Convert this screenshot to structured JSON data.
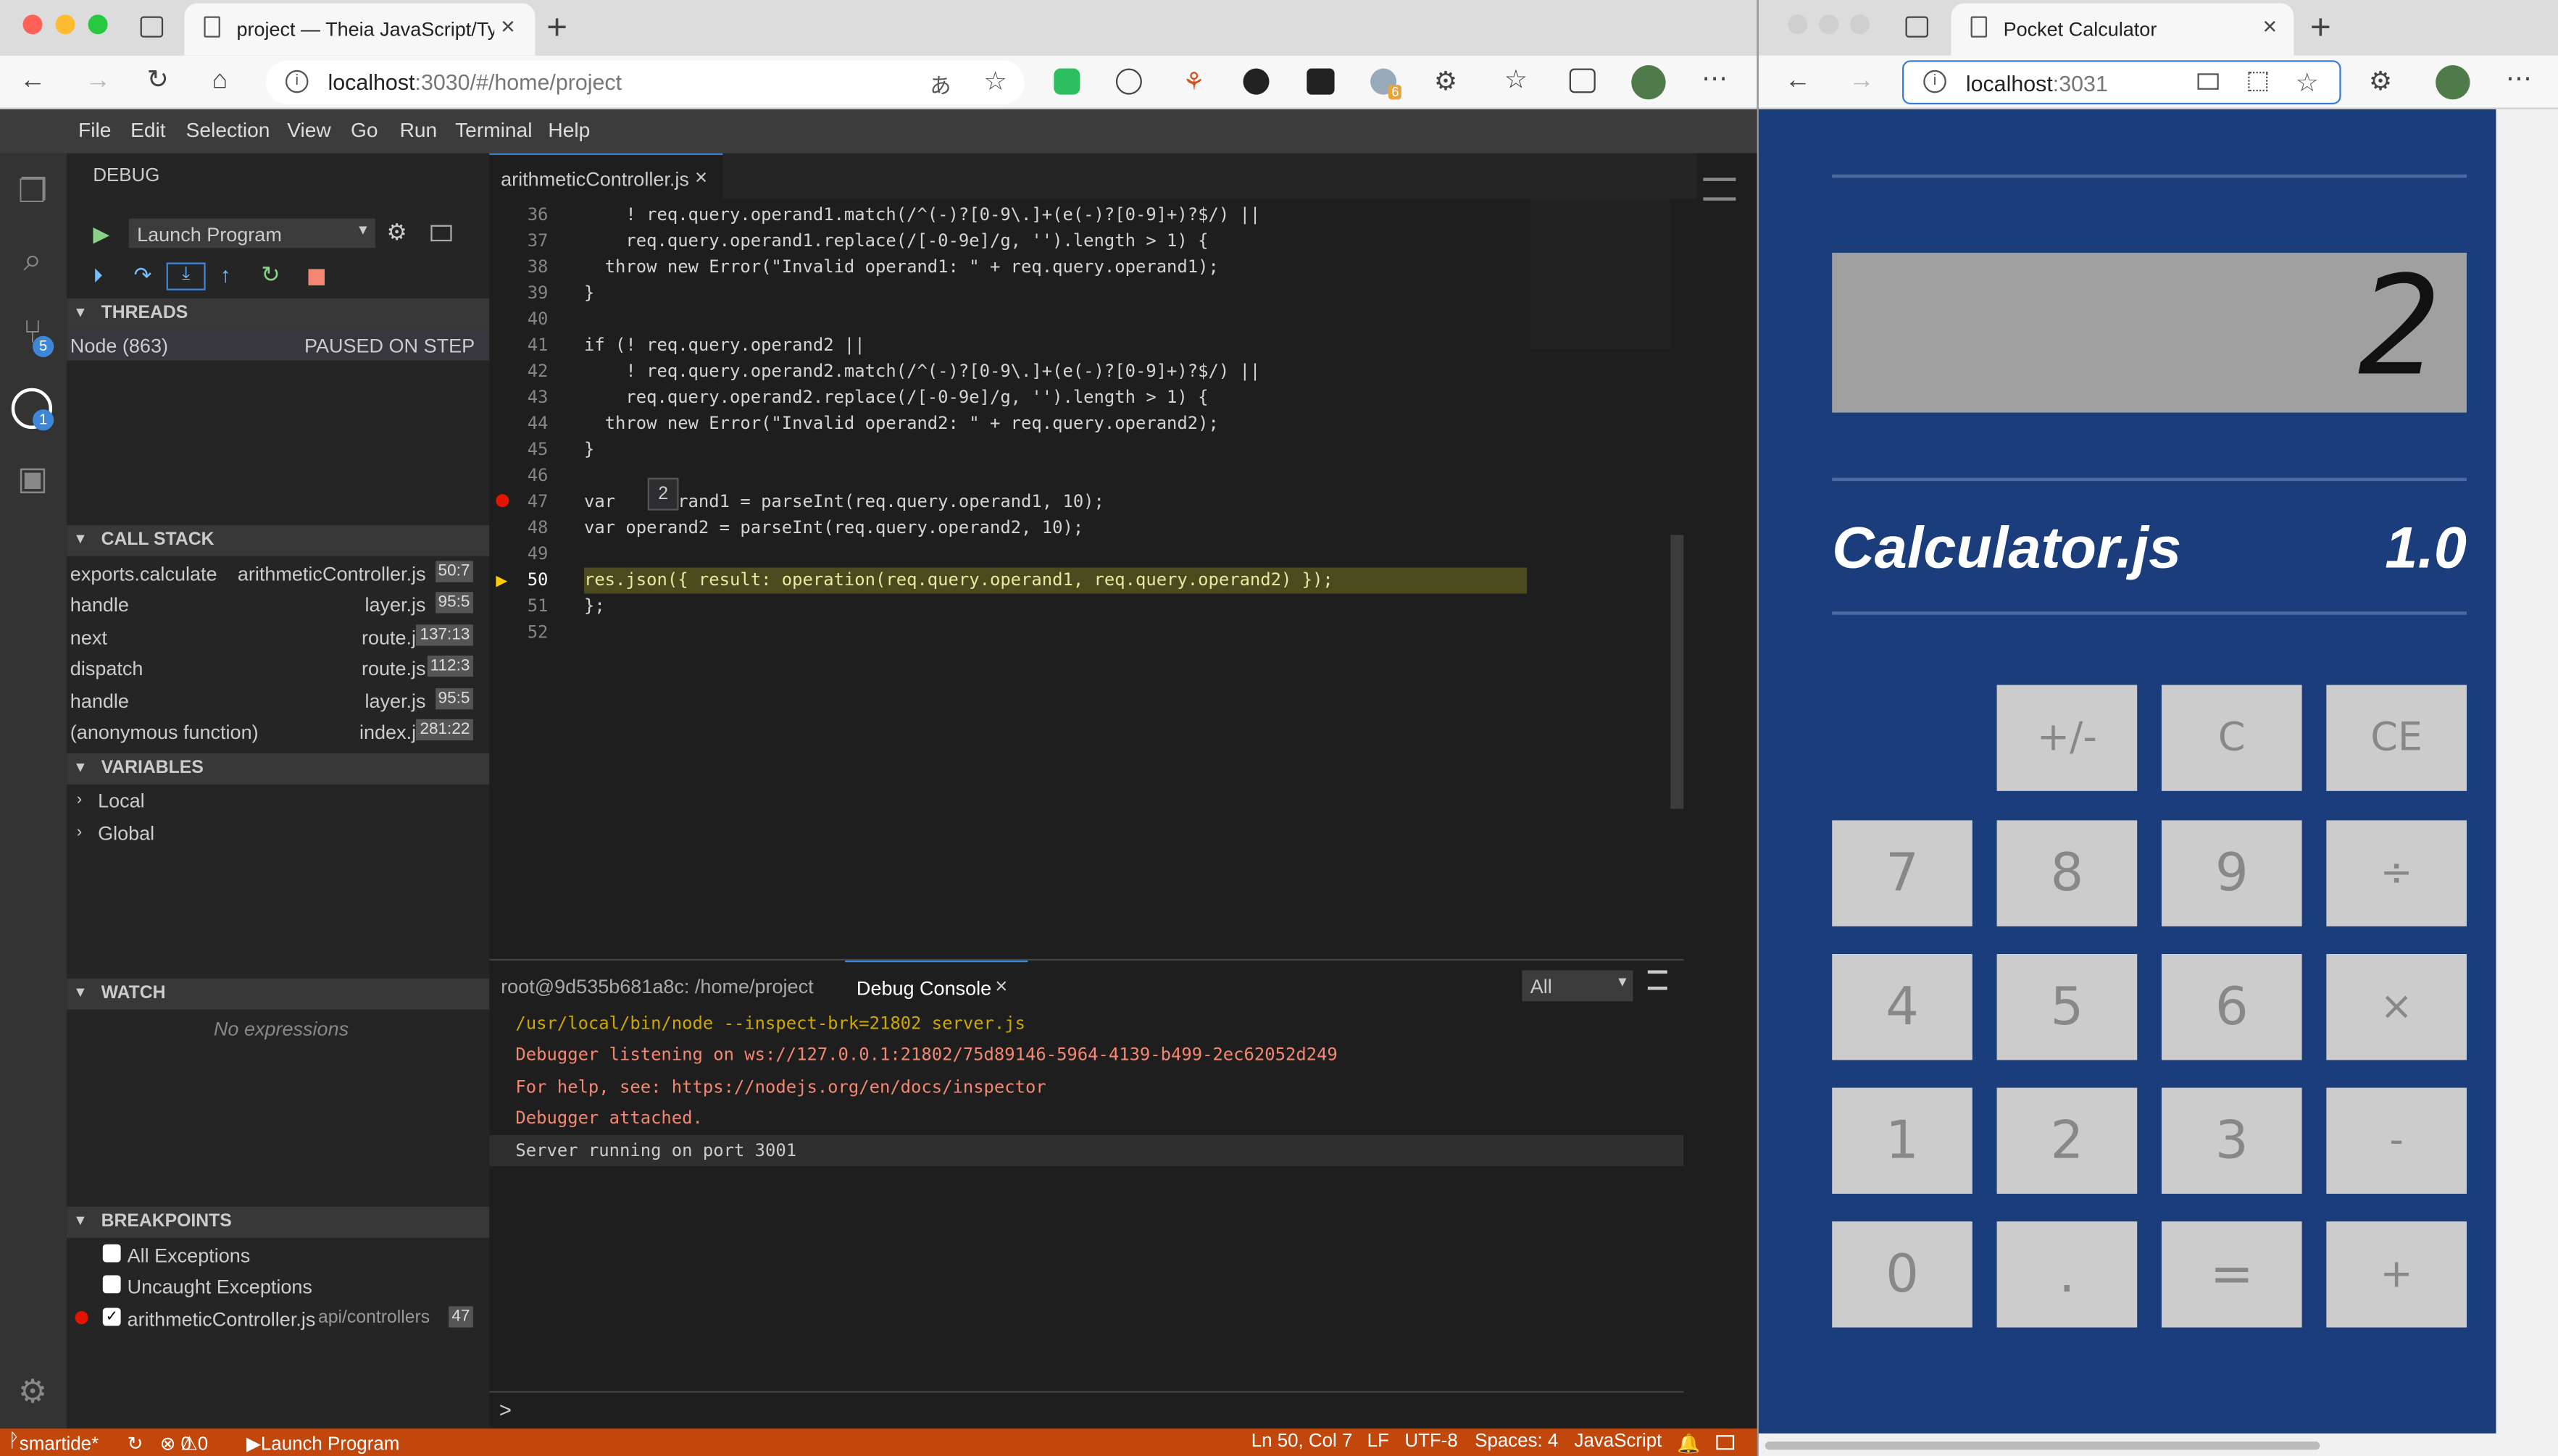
{
  "left_browser": {
    "tab_title": "project — Theia JavaScript/Typ",
    "url_host": "localhost",
    "url_rest": ":3030/#/home/project",
    "ext_badge": "6"
  },
  "right_browser": {
    "tab_title": "Pocket Calculator",
    "url_host": "localhost",
    "url_rest": ":3031"
  },
  "menu": [
    "File",
    "Edit",
    "Selection",
    "View",
    "Go",
    "Run",
    "Terminal",
    "Help"
  ],
  "activity": {
    "scm_badge": "5",
    "debug_badge": "1"
  },
  "debug": {
    "title": "DEBUG",
    "config": "Launch Program",
    "threads_label": "THREADS",
    "thread_name": "Node (863)",
    "thread_state": "PAUSED ON STEP",
    "callstack_label": "CALL STACK",
    "frames": [
      {
        "name": "exports.calculate",
        "file": "arithmeticController.js",
        "pos": "50:7"
      },
      {
        "name": "handle",
        "file": "layer.js",
        "pos": "95:5"
      },
      {
        "name": "next",
        "file": "route.js",
        "pos": "137:13"
      },
      {
        "name": "dispatch",
        "file": "route.js",
        "pos": "112:3"
      },
      {
        "name": "handle",
        "file": "layer.js",
        "pos": "95:5"
      },
      {
        "name": "(anonymous function)",
        "file": "index.js",
        "pos": "281:22"
      }
    ],
    "variables_label": "VARIABLES",
    "scopes": [
      "Local",
      "Global"
    ],
    "watch_label": "WATCH",
    "watch_empty": "No expressions",
    "breakpoints_label": "BREAKPOINTS",
    "bp_all": "All Exceptions",
    "bp_uncaught": "Uncaught Exceptions",
    "bp_file": "arithmeticController.js",
    "bp_path": "api/controllers",
    "bp_line": "47"
  },
  "editor": {
    "tab": "arithmeticController.js",
    "hover_value": "2",
    "lines": [
      {
        "n": "36",
        "t": "    ! req.query.operand1.match(/^(-)?[0-9\\.]+(e(-)?[0-9]+)?$/) ||"
      },
      {
        "n": "37",
        "t": "    req.query.operand1.replace(/[-0-9e]/g, '').length > 1) {"
      },
      {
        "n": "38",
        "t": "  throw new Error(\"Invalid operand1: \" + req.query.operand1);"
      },
      {
        "n": "39",
        "t": "}"
      },
      {
        "n": "40",
        "t": ""
      },
      {
        "n": "41",
        "t": "if (! req.query.operand2 ||"
      },
      {
        "n": "42",
        "t": "    ! req.query.operand2.match(/^(-)?[0-9\\.]+(e(-)?[0-9]+)?$/) ||"
      },
      {
        "n": "43",
        "t": "    req.query.operand2.replace(/[-0-9e]/g, '').length > 1) {"
      },
      {
        "n": "44",
        "t": "  throw new Error(\"Invalid operand2: \" + req.query.operand2);"
      },
      {
        "n": "45",
        "t": "}"
      },
      {
        "n": "46",
        "t": ""
      },
      {
        "n": "47",
        "t": "var      rand1 = parseInt(req.query.operand1, 10);"
      },
      {
        "n": "48",
        "t": "var operand2 = parseInt(req.query.operand2, 10);"
      },
      {
        "n": "49",
        "t": ""
      },
      {
        "n": "50",
        "t": "res.json({ result: operation(req.query.operand1, req.query.operand2) });"
      },
      {
        "n": "51",
        "t": "};"
      },
      {
        "n": "52",
        "t": ""
      }
    ]
  },
  "panel": {
    "terminal_tab": "root@9d535b681a8c: /home/project",
    "console_tab": "Debug Console",
    "filter": "All",
    "output": [
      "/usr/local/bin/node --inspect-brk=21802 server.js",
      "Debugger listening on ws://127.0.0.1:21802/75d89146-5964-4139-b499-2ec62052d249",
      "For help, see: https://nodejs.org/en/docs/inspector",
      "Debugger attached.",
      "Server running on port 3001"
    ],
    "prompt": ">"
  },
  "status": {
    "branch": "smartide*",
    "errors": "0",
    "warnings": "0",
    "launch": "Launch Program",
    "position": "Ln 50, Col 7",
    "eol": "LF",
    "encoding": "UTF-8",
    "indent": "Spaces: 4",
    "language": "JavaScript"
  },
  "calculator": {
    "display": "2",
    "title": "Calculator.js",
    "version": "1.0",
    "keys": [
      [
        "",
        "+/-",
        "C",
        "CE"
      ],
      [
        "7",
        "8",
        "9",
        "÷"
      ],
      [
        "4",
        "5",
        "6",
        "×"
      ],
      [
        "1",
        "2",
        "3",
        "-"
      ],
      [
        "0",
        ".",
        "=",
        "+"
      ]
    ]
  }
}
